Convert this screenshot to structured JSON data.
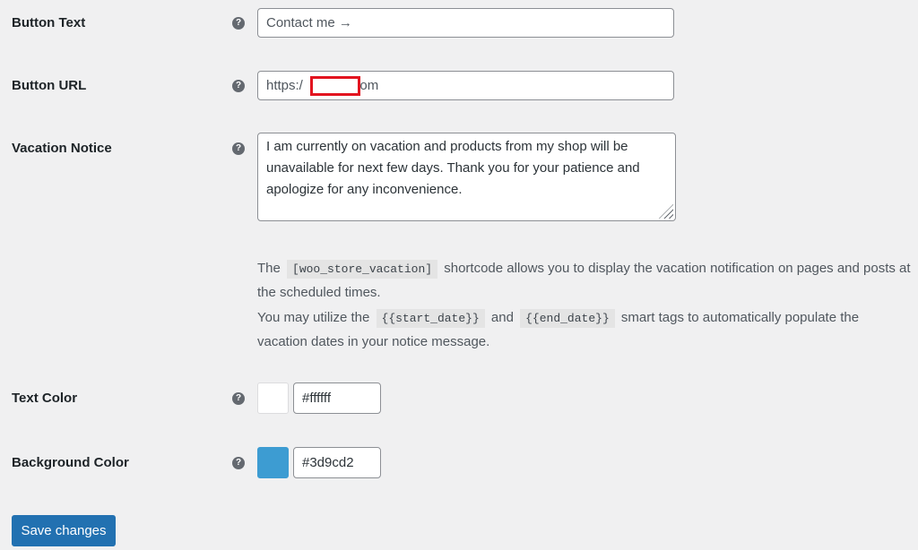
{
  "fields": {
    "button_text": {
      "label": "Button Text",
      "value": "Contact me →"
    },
    "button_url": {
      "label": "Button URL",
      "value_prefix": "https:/",
      "value_suffix": "com"
    },
    "vacation_notice": {
      "label": "Vacation Notice",
      "value": "I am currently on vacation and products from my shop will be unavailable for next few days. Thank you for your patience and apologize for any inconvenience."
    },
    "text_color": {
      "label": "Text Color",
      "value": "#ffffff"
    },
    "background_color": {
      "label": "Background Color",
      "value": "#3d9cd2"
    }
  },
  "help_icon_glyph": "?",
  "description": {
    "line1_pre": "The",
    "shortcode": "[woo_store_vacation]",
    "line1_post": "shortcode allows you to display the vacation notification on pages and posts at the scheduled times.",
    "line2_pre": "You may utilize the",
    "tag_start": "{{start_date}}",
    "line2_mid": "and",
    "tag_end": "{{end_date}}",
    "line2_post": "smart tags to automatically populate the vacation dates in your notice message."
  },
  "colors": {
    "text_swatch": "#ffffff",
    "background_swatch": "#3d9cd2",
    "primary_button": "#2271b1"
  },
  "save_button": {
    "label": "Save changes"
  }
}
